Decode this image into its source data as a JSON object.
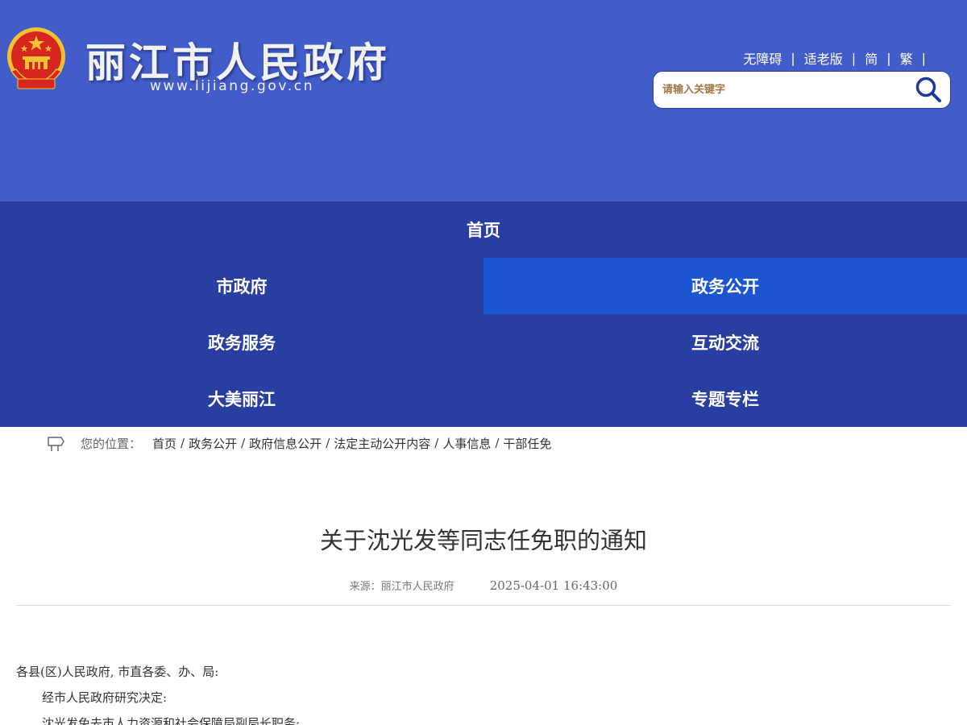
{
  "header": {
    "title": "丽江市人民政府",
    "domain": "www.lijiang.gov.cn",
    "top_links": [
      "无障碍",
      "适老版",
      "简",
      "繁"
    ],
    "search": {
      "placeholder": "请输入关键字"
    },
    "colors": {
      "background": "#425dc9",
      "emblem_red": "#d6261f",
      "emblem_gold": "#f2c230"
    }
  },
  "nav": {
    "home": "首页",
    "items": [
      {
        "label": "市政府",
        "active": false
      },
      {
        "label": "政务公开",
        "active": true
      },
      {
        "label": "政务服务",
        "active": false
      },
      {
        "label": "互动交流",
        "active": false
      },
      {
        "label": "大美丽江",
        "active": false
      },
      {
        "label": "专题专栏",
        "active": false
      }
    ],
    "colors": {
      "background": "#293ea1",
      "active": "#1b55d1"
    }
  },
  "breadcrumb": {
    "icon": "signpost-icon",
    "label": "您的位置：",
    "items": [
      "首页",
      "政务公开",
      "政府信息公开",
      "法定主动公开内容",
      "人事信息",
      "干部任免"
    ],
    "separator": "/"
  },
  "article": {
    "title": "关于沈光发等同志任免职的通知",
    "source": "来源：丽江市人民政府",
    "date": "2025-04-01 16:43:00",
    "paragraphs": [
      "各县(区)人民政府, 市直各委、办、局:",
      "经市人民政府研究决定:",
      "沈光发免去市人力资源和社会保障局副局长职务;"
    ]
  }
}
